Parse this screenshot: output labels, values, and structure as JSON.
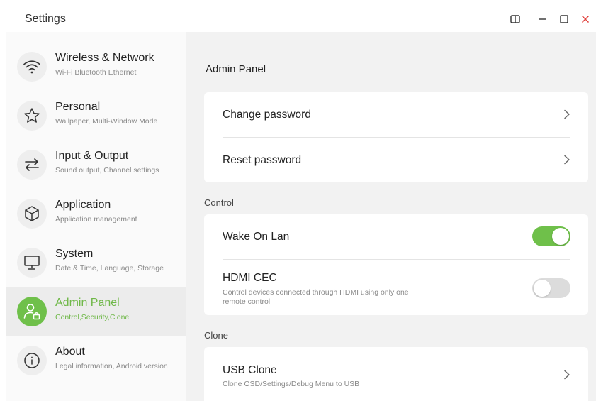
{
  "window": {
    "title": "Settings",
    "controls": [
      "split-view-icon",
      "minimize-icon",
      "maximize-icon",
      "close-icon"
    ]
  },
  "sidebar": {
    "items": [
      {
        "title": "Wireless & Network",
        "subtitle": "Wi-Fi Bluetooth Ethernet",
        "icon": "wifi-icon",
        "active": false
      },
      {
        "title": "Personal",
        "subtitle": "Wallpaper, Multi-Window Mode",
        "icon": "star-icon",
        "active": false
      },
      {
        "title": "Input & Output",
        "subtitle": "Sound output, Channel settings",
        "icon": "swap-arrows-icon",
        "active": false
      },
      {
        "title": "Application",
        "subtitle": "Application management",
        "icon": "cube-icon",
        "active": false
      },
      {
        "title": "System",
        "subtitle": "Date & Time, Language, Storage",
        "icon": "monitor-icon",
        "active": false
      },
      {
        "title": "Admin Panel",
        "subtitle": "Control,Security,Clone",
        "icon": "admin-user-lock-icon",
        "active": true
      },
      {
        "title": "About",
        "subtitle": "Legal information, Android version",
        "icon": "info-icon",
        "active": false
      }
    ]
  },
  "main": {
    "title": "Admin Panel",
    "security_rows": {
      "change_password": "Change password",
      "reset_password": "Reset password"
    },
    "control": {
      "label": "Control",
      "wake_on_lan": {
        "label": "Wake On Lan",
        "enabled": true
      },
      "hdmi_cec": {
        "label": "HDMI CEC",
        "description": "Control devices connected through HDMI using only one remote control",
        "enabled": false
      }
    },
    "clone": {
      "label": "Clone",
      "usb_clone": {
        "label": "USB Clone",
        "description": "Clone OSD/Settings/Debug Menu to USB"
      }
    }
  },
  "colors": {
    "accent": "#6fc04a",
    "background": "#f2f2f2",
    "close": "#e0413d"
  }
}
